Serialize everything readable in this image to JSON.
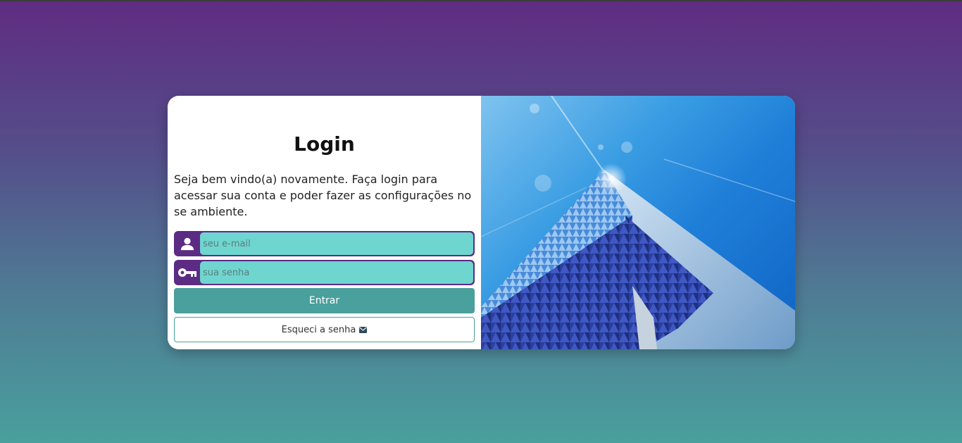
{
  "login": {
    "title": "Login",
    "description": "Seja bem vindo(a) novamente. Faça login para acessar sua conta e poder fazer as configurações no se ambiente.",
    "email_placeholder": "seu e-mail",
    "password_placeholder": "sua senha",
    "submit_label": "Entrar",
    "forgot_label": "Esqueci a senha"
  },
  "icons": {
    "email": "user-icon",
    "password": "key-icon",
    "forgot": "envelope-icon"
  },
  "colors": {
    "primary_purple": "#5c2b84",
    "input_teal": "#6fd5cf",
    "button_teal": "#49a09d"
  }
}
